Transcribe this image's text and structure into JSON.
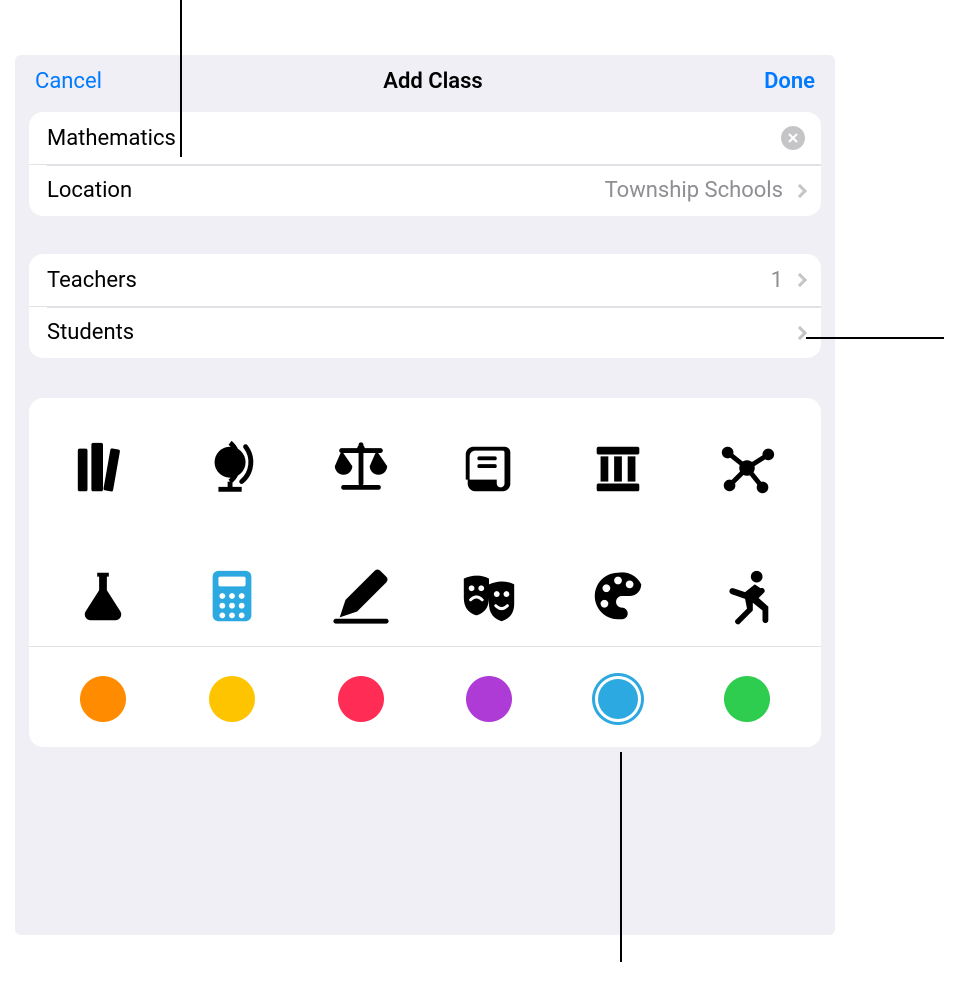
{
  "nav": {
    "cancel": "Cancel",
    "title": "Add Class",
    "done": "Done"
  },
  "class_name": "Mathematics",
  "location": {
    "label": "Location",
    "value": "Township Schools"
  },
  "members": {
    "teachers_label": "Teachers",
    "teachers_count": "1",
    "students_label": "Students",
    "students_count": ""
  },
  "icons": [
    {
      "name": "books-icon",
      "selected": false
    },
    {
      "name": "globe-icon",
      "selected": false
    },
    {
      "name": "scales-icon",
      "selected": false
    },
    {
      "name": "scroll-icon",
      "selected": false
    },
    {
      "name": "column-icon",
      "selected": false
    },
    {
      "name": "molecule-icon",
      "selected": false
    },
    {
      "name": "flask-icon",
      "selected": false
    },
    {
      "name": "calculator-icon",
      "selected": true
    },
    {
      "name": "pencil-icon",
      "selected": false
    },
    {
      "name": "masks-icon",
      "selected": false
    },
    {
      "name": "palette-icon",
      "selected": false
    },
    {
      "name": "runner-icon",
      "selected": false
    }
  ],
  "colors": [
    {
      "name": "orange",
      "hex": "#ff8c00",
      "selected": false
    },
    {
      "name": "yellow",
      "hex": "#ffc400",
      "selected": false
    },
    {
      "name": "pink",
      "hex": "#ff2d55",
      "selected": false
    },
    {
      "name": "purple",
      "hex": "#af3bd6",
      "selected": false
    },
    {
      "name": "blue",
      "hex": "#2ca9e1",
      "selected": true
    },
    {
      "name": "green",
      "hex": "#2ecc4f",
      "selected": false
    }
  ]
}
